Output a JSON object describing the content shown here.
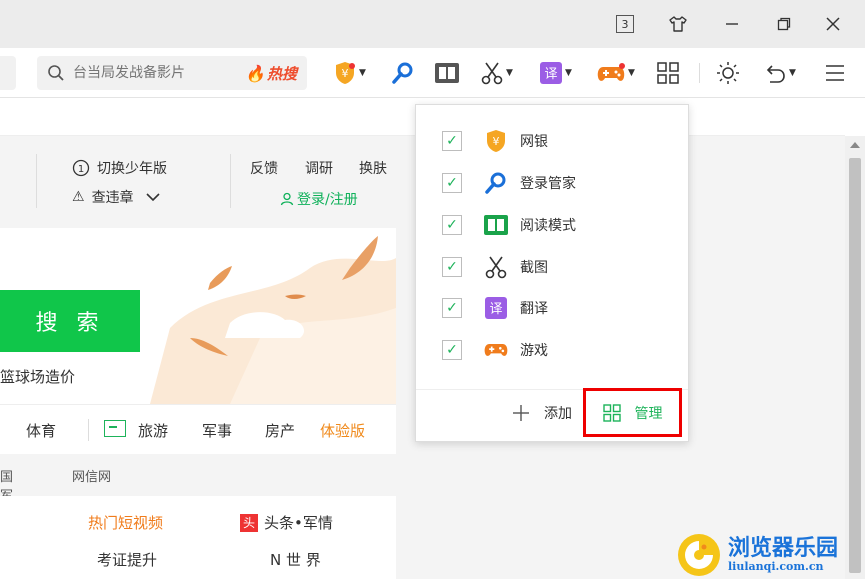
{
  "titlebar": {
    "badge": "3",
    "buttons": [
      "skin",
      "minimize",
      "restore",
      "close"
    ]
  },
  "toolbar": {
    "search": {
      "placeholder": "台当局发战备影片",
      "hot_label": "热搜"
    },
    "icons": [
      "bank-icon",
      "login-manager-icon",
      "reader-icon",
      "scissors-icon",
      "translate-icon",
      "game-icon",
      "apps-grid-icon",
      "brightness-icon",
      "undo-icon",
      "menu-icon"
    ]
  },
  "page": {
    "top_menu": {
      "switch_teen": "切换少年版",
      "violation": "查违章",
      "feedback": "反馈",
      "survey": "调研",
      "skin": "换肤",
      "login": "登录/注册"
    },
    "search_button": "搜 索",
    "suggestion": "篮球场造价",
    "nav": [
      "体育",
      "旅游",
      "军事",
      "房产",
      "体验版"
    ],
    "links": [
      "国军网",
      "网信网"
    ],
    "news": [
      "热门短视频",
      "头条•军情",
      "考证提升",
      "N 世 界"
    ]
  },
  "dropdown": {
    "items": [
      {
        "label": "网银",
        "icon": "bank-icon",
        "checked": true
      },
      {
        "label": "登录管家",
        "icon": "login-manager-icon",
        "checked": true
      },
      {
        "label": "阅读模式",
        "icon": "reader-icon",
        "checked": true
      },
      {
        "label": "截图",
        "icon": "scissors-icon",
        "checked": true
      },
      {
        "label": "翻译",
        "icon": "translate-icon",
        "checked": true
      },
      {
        "label": "游戏",
        "icon": "game-icon",
        "checked": true
      }
    ],
    "add_label": "添加",
    "manage_label": "管理"
  },
  "watermark": {
    "name": "浏览器乐园",
    "url": "liulanqi.com.cn"
  },
  "colors": {
    "accent_green": "#1db35a",
    "search_green": "#10c64a",
    "hot_red": "#ee4d2d",
    "highlight_red": "#e00000",
    "orange": "#f08a1c"
  }
}
